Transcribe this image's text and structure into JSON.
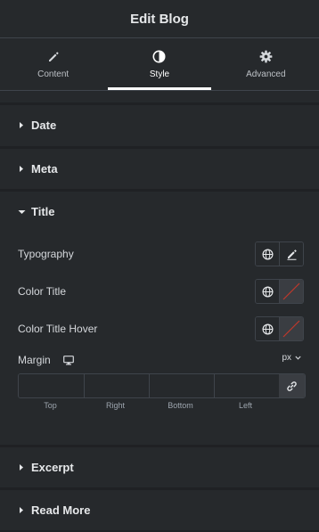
{
  "header": {
    "title": "Edit Blog"
  },
  "tabs": [
    {
      "label": "Content",
      "icon": "pencil-icon"
    },
    {
      "label": "Style",
      "icon": "half-circle-icon",
      "active": true
    },
    {
      "label": "Advanced",
      "icon": "gear-icon"
    }
  ],
  "sections": {
    "date": "Date",
    "meta": "Meta",
    "title": "Title",
    "excerpt": "Excerpt",
    "read_more": "Read More"
  },
  "title_section": {
    "typography_label": "Typography",
    "color_title_label": "Color Title",
    "color_title_hover_label": "Color Title Hover",
    "margin_label": "Margin",
    "margin_unit": "px",
    "margin_fields": {
      "top": {
        "caption": "Top",
        "value": ""
      },
      "right": {
        "caption": "Right",
        "value": ""
      },
      "bottom": {
        "caption": "Bottom",
        "value": ""
      },
      "left": {
        "caption": "Left",
        "value": ""
      }
    }
  },
  "colors": {
    "background": "#26292c",
    "divider": "#1f2124",
    "border": "#3f444b",
    "swatch_empty_line": "#c0392b"
  }
}
